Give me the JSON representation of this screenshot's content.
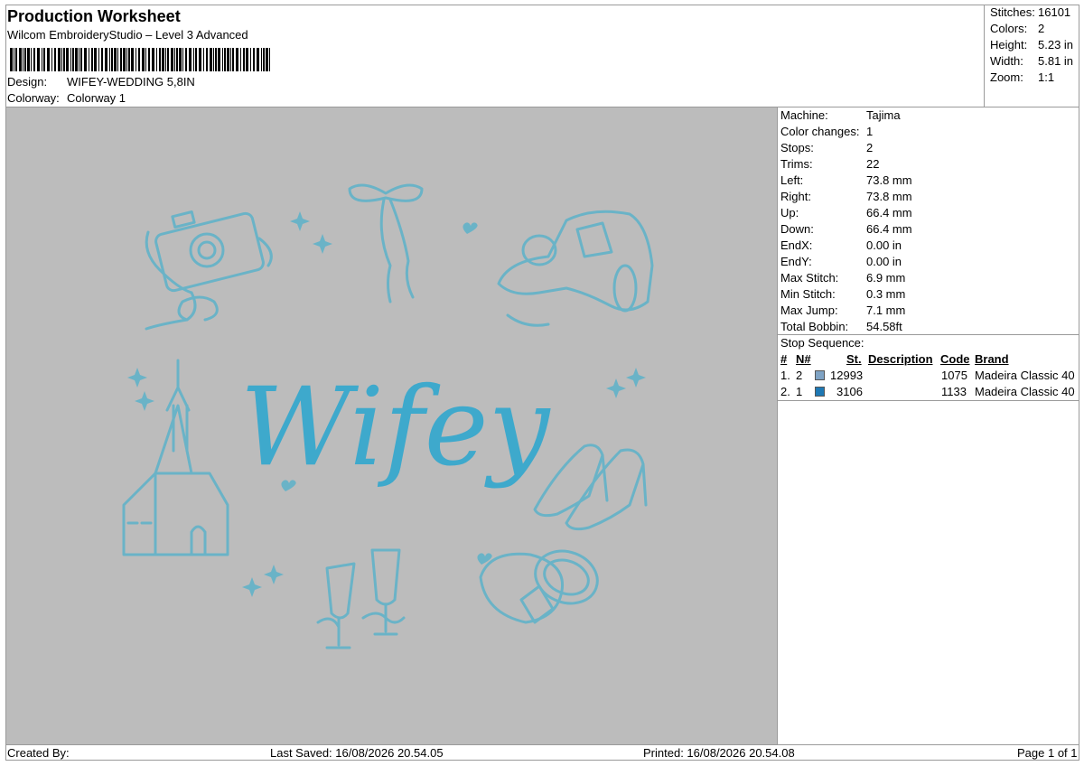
{
  "header": {
    "title": "Production Worksheet",
    "subtitle": "Wilcom EmbroideryStudio – Level 3 Advanced",
    "design_label": "Design:",
    "design_value": "WIFEY-WEDDING 5,8IN",
    "colorway_label": "Colorway:",
    "colorway_value": "Colorway 1"
  },
  "stats": [
    {
      "label": "Stitches:",
      "value": "16101"
    },
    {
      "label": "Colors:",
      "value": "2"
    },
    {
      "label": "Height:",
      "value": "5.23 in"
    },
    {
      "label": "Width:",
      "value": "5.81 in"
    },
    {
      "label": "Zoom:",
      "value": "1:1"
    }
  ],
  "properties": [
    {
      "label": "Machine:",
      "value": "Tajima"
    },
    {
      "label": "Color changes:",
      "value": "1"
    },
    {
      "label": "Stops:",
      "value": "2"
    },
    {
      "label": "Trims:",
      "value": "22"
    },
    {
      "label": "Left:",
      "value": "73.8 mm"
    },
    {
      "label": "Right:",
      "value": "73.8 mm"
    },
    {
      "label": "Up:",
      "value": "66.4 mm"
    },
    {
      "label": "Down:",
      "value": "66.4 mm"
    },
    {
      "label": "EndX:",
      "value": "0.00 in"
    },
    {
      "label": "EndY:",
      "value": "0.00 in"
    },
    {
      "label": "Max Stitch:",
      "value": "6.9 mm"
    },
    {
      "label": "Min Stitch:",
      "value": "0.3 mm"
    },
    {
      "label": "Max Jump:",
      "value": "7.1 mm"
    },
    {
      "label": "Total Bobbin:",
      "value": "54.58ft"
    }
  ],
  "stop_sequence": {
    "title": "Stop Sequence:",
    "headers": {
      "num": "#",
      "n": "N#",
      "st": "St.",
      "description": "Description",
      "code": "Code",
      "brand": "Brand"
    },
    "rows": [
      {
        "num": "1.",
        "n": "2",
        "color": "#7fa3c4",
        "st": "12993",
        "description": "",
        "code": "1075",
        "brand": "Madeira Classic 40"
      },
      {
        "num": "2.",
        "n": "1",
        "color": "#1e78b4",
        "st": "3106",
        "description": "",
        "code": "1133",
        "brand": "Madeira Classic 40"
      }
    ]
  },
  "design": {
    "text": "Wifey",
    "background": "#bcbcbc",
    "outline_color": "#6ab3c7",
    "text_color": "#3ea9cc"
  },
  "footer": {
    "created_by": "Created By:",
    "last_saved": "Last Saved: 16/08/2026 20.54.05",
    "printed": "Printed: 16/08/2026 20.54.08",
    "page": "Page 1 of 1"
  }
}
